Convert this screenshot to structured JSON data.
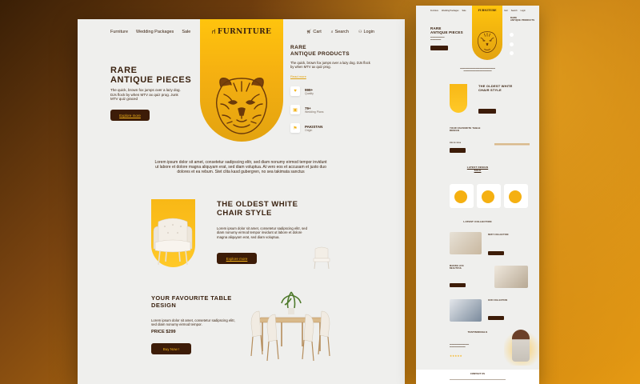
{
  "main": {
    "nav": {
      "furniture": "Furniture",
      "wedding": "Wedding Packages",
      "sale": "Sale",
      "cart": "Cart",
      "search": "Search",
      "login": "Login"
    },
    "logo": "FURNITURE",
    "hero": {
      "title_line1": "RARE",
      "title_line2": "ANTIQUE PIECES",
      "text": "The quick, brown fox jumps over a lazy dog. DJs flock by when MTV ax quiz prog. Junk MTV quiz graced",
      "button": "Explore more"
    },
    "rare": {
      "title_line1": "RARE",
      "title_line2": "ANTIQUE PRODUCTS",
      "text": "The quick, brown fox jumps over a lazy dog. DJs flock by when MTV ax quiz prog.",
      "link": "Read more"
    },
    "stats": [
      {
        "value": "999+",
        "label": "Quality"
      },
      {
        "value": "79+",
        "label": "Wedding Plans"
      },
      {
        "value": "PAKISTAN",
        "label": "Origin"
      }
    ],
    "center_text": "Lorem ipsum dolor sit amet, consetetur sadipscing elitr, sed diam nonumy eirmod tempor invidunt ut labore et dolore magna aliquyam erat, sed diam voluptua. At vero eos et accusam et justo duo dolores et ea rebum. Stet clita kasd gubergren, no sea takimata sanctus",
    "oldest": {
      "title_line1": "THE OLDEST WHITE",
      "title_line2": "CHAIR STYLE",
      "text": "Lorem ipsum dolor sit amet, consetetur sadipscing elitr, sed diam nonumy eirmod tempor invidunt ut labore et dolore magna aliquyam erat, sed diam voluptua.",
      "button": "Explore more"
    },
    "table": {
      "title_line1": "YOUR FAVOURITE TABLE",
      "title_line2": "DESIGN",
      "text": "Lorem ipsum dolor sit amet, consetetur sadipscing elitr, sed diam nonumy eirmod tempor.",
      "price": "PRICE $299",
      "button": "Buy Now !"
    }
  },
  "side": {
    "nav_left": [
      "Furniture",
      "Wedding Packages",
      "Sale"
    ],
    "nav_right": [
      "Cart",
      "Search",
      "Login"
    ],
    "logo": "FURNITURE",
    "hero_title_line1": "RARE",
    "hero_title_line2": "ANTIQUE PIECES",
    "rare_title_line1": "RARE",
    "rare_title_line2": "ANTIQUE PRODUCTS",
    "oldest_title_line1": "THE OLDEST WHITE",
    "oldest_title_line2": "CHAIR STYLE",
    "table_title_line1": "YOUR FAVOURITE TABLE",
    "table_title_line2": "DESIGN",
    "table_price": "PRICE $299",
    "sale_title_line1": "LATEST DESIGN",
    "sale_title_line2": "SALE",
    "latest_collection": "LATEST COLLECTION",
    "best_collection": "BEST COLLECTION",
    "making_life_line1": "MAKING LIFE",
    "making_life_line2": "BEAUTIFUL",
    "our_collection": "OUR COLLECTION",
    "testimonials": "TESTIMONIALS",
    "stars": "★★★★★",
    "contact": "CONTACT US"
  },
  "colors": {
    "accent": "#f5b011",
    "dark": "#3d1c08",
    "page_bg": "#efefed"
  }
}
